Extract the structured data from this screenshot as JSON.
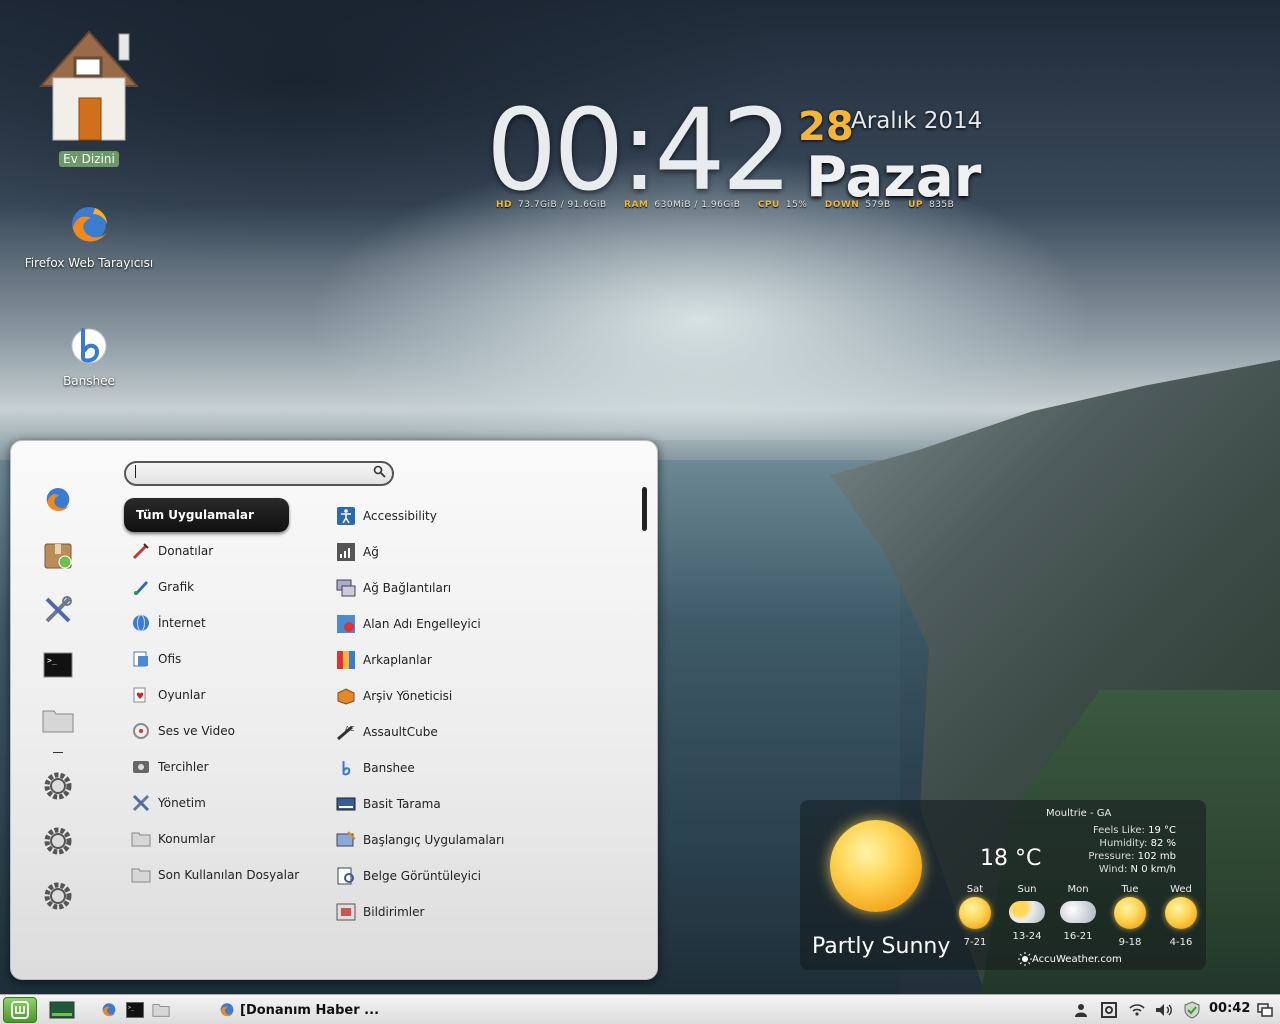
{
  "desktop": {
    "icons": [
      {
        "label": "Ev Dizini"
      },
      {
        "label": "Firefox Web Tarayıcısı"
      },
      {
        "label": "Banshee"
      }
    ]
  },
  "clock": {
    "time": "00:42",
    "day": "28",
    "month_year": "Aralık 2014",
    "weekday": "Pazar"
  },
  "sysmon": {
    "hd_label": "HD",
    "hd_value": "73.7GiB / 91.6GiB",
    "ram_label": "RAM",
    "ram_value": "630MiB / 1.96GiB",
    "cpu_label": "CPU",
    "cpu_value": "15%",
    "down_label": "DOWN",
    "down_value": "579B",
    "up_label": "UP",
    "up_value": "835B"
  },
  "menu": {
    "search_value": "",
    "active_category": "Tüm Uygulamalar",
    "categories": [
      {
        "label": "Donatılar",
        "icon": "accessories-icon"
      },
      {
        "label": "Grafik",
        "icon": "graphics-icon"
      },
      {
        "label": "İnternet",
        "icon": "internet-icon"
      },
      {
        "label": "Ofis",
        "icon": "office-icon"
      },
      {
        "label": "Oyunlar",
        "icon": "games-icon"
      },
      {
        "label": "Ses ve Video",
        "icon": "multimedia-icon"
      },
      {
        "label": "Tercihler",
        "icon": "preferences-icon"
      },
      {
        "label": "Yönetim",
        "icon": "administration-icon"
      },
      {
        "label": "Konumlar",
        "icon": "folder-icon"
      },
      {
        "label": "Son Kullanılan Dosyalar",
        "icon": "folder-icon"
      }
    ],
    "apps": [
      {
        "label": "Accessibility",
        "icon": "accessibility-icon"
      },
      {
        "label": "Ağ",
        "icon": "network-icon"
      },
      {
        "label": "Ağ Bağlantıları",
        "icon": "network-connections-icon"
      },
      {
        "label": "Alan Adı Engelleyici",
        "icon": "domain-blocker-icon"
      },
      {
        "label": "Arkaplanlar",
        "icon": "backgrounds-icon"
      },
      {
        "label": "Arşiv Yöneticisi",
        "icon": "archive-manager-icon"
      },
      {
        "label": "AssaultCube",
        "icon": "assaultcube-icon"
      },
      {
        "label": "Banshee",
        "icon": "banshee-icon"
      },
      {
        "label": "Basit Tarama",
        "icon": "scanner-icon"
      },
      {
        "label": "Başlangıç Uygulamaları",
        "icon": "startup-apps-icon"
      },
      {
        "label": "Belge Görüntüleyici",
        "icon": "document-viewer-icon"
      },
      {
        "label": "Bildirimler",
        "icon": "notifications-icon"
      }
    ],
    "favorites": [
      "firefox-icon",
      "package-manager-icon",
      "system-tools-icon",
      "terminal-icon",
      "files-icon",
      "settings-icon",
      "settings-icon",
      "settings-icon"
    ]
  },
  "weather": {
    "location": "Moultrie - GA",
    "temperature": "18 °C",
    "condition": "Partly Sunny",
    "feels_like_label": "Feels Like:",
    "feels_like": "19 °C",
    "humidity_label": "Humidity:",
    "humidity": "82 %",
    "pressure_label": "Pressure:",
    "pressure": "102 mb",
    "wind_label": "Wind:",
    "wind": "N 0 km/h",
    "forecast": [
      {
        "day": "Sat",
        "range": "7-21",
        "icon": "sunny-icon"
      },
      {
        "day": "Sun",
        "range": "13-24",
        "icon": "partly-cloudy-icon"
      },
      {
        "day": "Mon",
        "range": "16-21",
        "icon": "cloudy-icon"
      },
      {
        "day": "Tue",
        "range": "9-18",
        "icon": "sunny-icon"
      },
      {
        "day": "Wed",
        "range": "4-16",
        "icon": "sunny-icon"
      }
    ],
    "provider": "AccuWeather.com"
  },
  "taskbar": {
    "task_title": "[Donanım Haber ...",
    "clock": "00:42"
  }
}
